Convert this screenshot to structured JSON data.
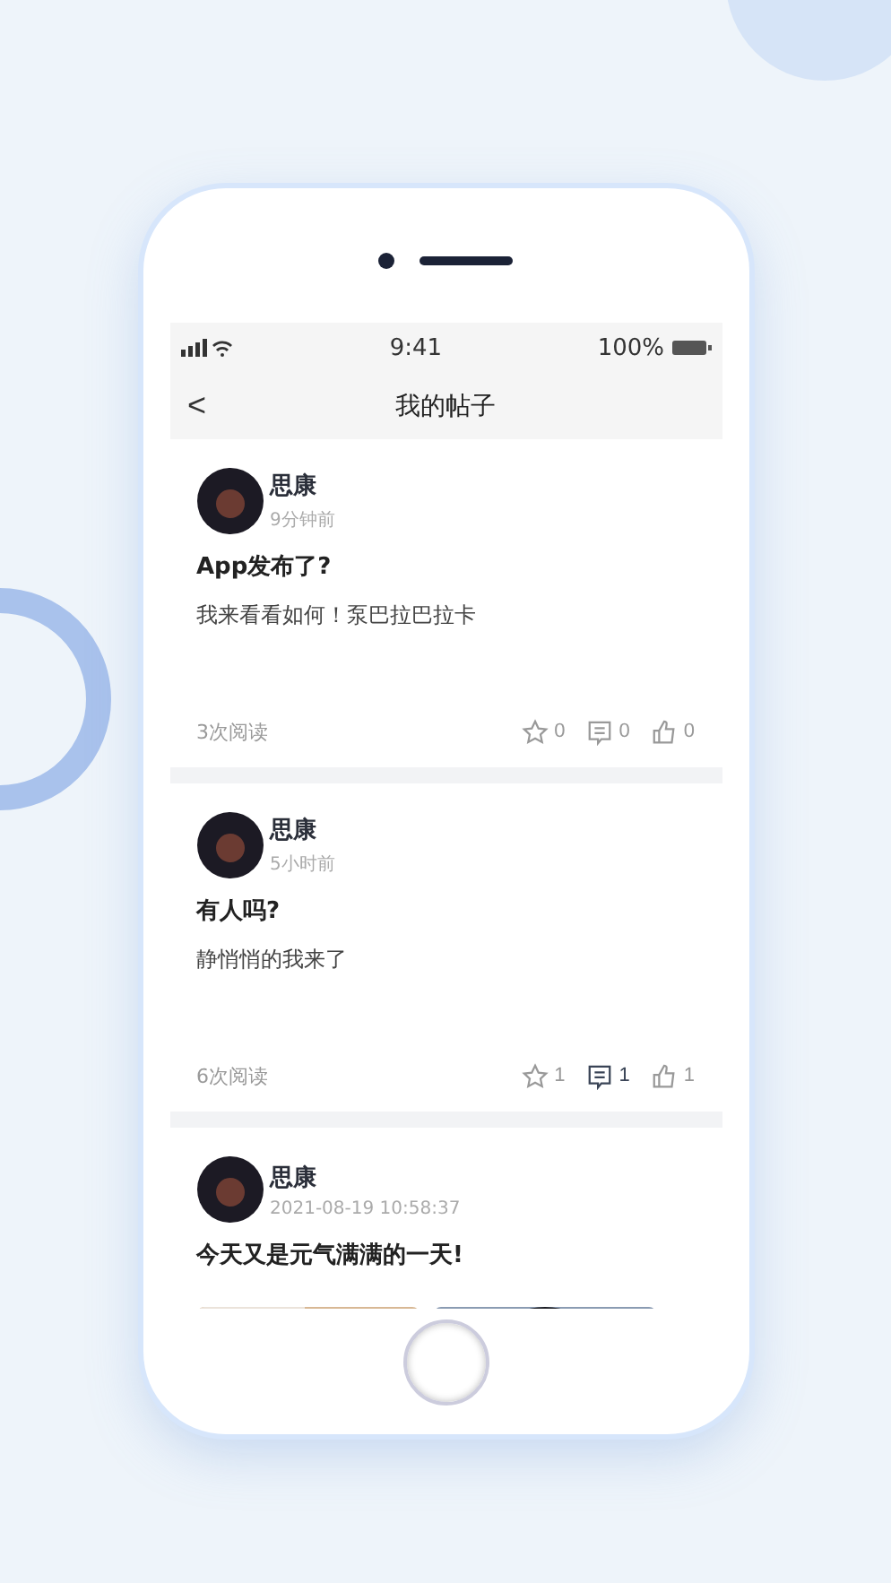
{
  "status_bar": {
    "time": "9:41",
    "battery": "100%"
  },
  "nav": {
    "back": "<",
    "title": "我的帖子"
  },
  "posts": [
    {
      "author": "思康",
      "time": "9分钟前",
      "title": "App发布了?",
      "body": "我来看看如何！泵巴拉巴拉卡",
      "reads": "3次阅读",
      "actions": [
        {
          "kind": "star",
          "count": "0",
          "active": false
        },
        {
          "kind": "comment",
          "count": "0",
          "active": false
        },
        {
          "kind": "like",
          "count": "0",
          "active": false
        }
      ]
    },
    {
      "author": "思康",
      "time": "5小时前",
      "title": "有人吗?",
      "body": "静悄悄的我来了",
      "reads": "6次阅读",
      "actions": [
        {
          "kind": "star",
          "count": "1",
          "active": false
        },
        {
          "kind": "comment",
          "count": "1",
          "active": true
        },
        {
          "kind": "like",
          "count": "1",
          "active": false
        }
      ]
    },
    {
      "author": "思康",
      "time": "2021-08-19 10:58:37",
      "title": "今天又是元气满满的一天!"
    }
  ]
}
